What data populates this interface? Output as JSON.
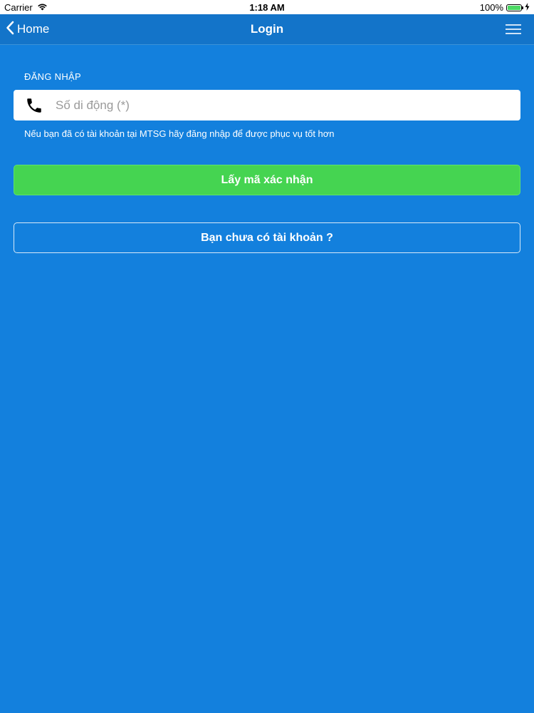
{
  "status_bar": {
    "carrier": "Carrier",
    "time": "1:18 AM",
    "battery_percent": "100%",
    "battery_level": 1.0
  },
  "nav": {
    "back_label": "Home",
    "title": "Login",
    "back_icon": "chevron-left-icon",
    "menu_icon": "hamburger-menu-icon"
  },
  "form": {
    "section_label": "ĐĂNG NHẬP",
    "phone_placeholder": "Số di động (*)",
    "phone_value": "",
    "phone_icon": "phone-icon",
    "helper_text": "Nếu bạn đã có tài khoản tại MTSG hãy đăng nhập để được phục vụ tốt hơn",
    "otp_button_label": "Lấy mã xác nhận",
    "register_button_label": "Bạn chưa có tài khoản ?"
  },
  "colors": {
    "background": "#1380dd",
    "nav_background": "#1374c9",
    "primary_button": "#45d451",
    "battery_fill": "#4cd964"
  }
}
